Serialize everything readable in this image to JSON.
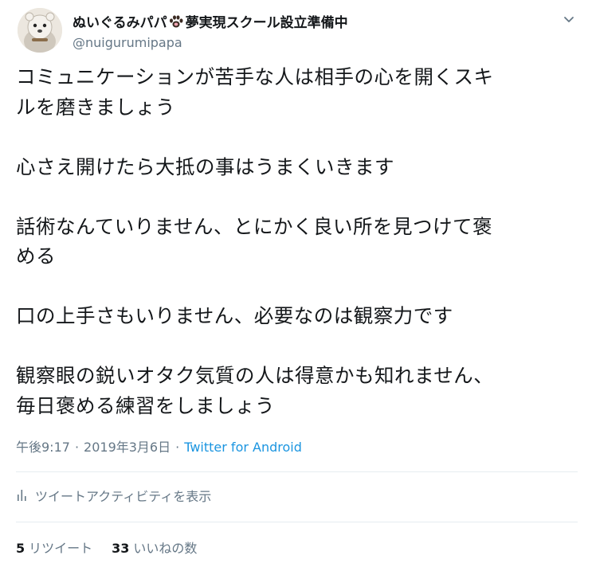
{
  "author": {
    "display_name": "ぬいぐるみパパ",
    "display_name_suffix": "夢実現スクール設立準備中",
    "handle": "@nuigurumipapa",
    "avatar_icon": "stuffed-toy-avatar",
    "badge_icon": "paw-icon"
  },
  "menu_icon": "chevron-down-icon",
  "tweet": {
    "paragraphs": [
      [
        "コミュニケーションが苦手な人は相手の心を開くスキ",
        "ルを磨きましょう"
      ],
      [
        "心さえ開けたら大抵の事はうまくいきます"
      ],
      [
        "話術なんていりません、とにかく良い所を見つけて褒",
        "める"
      ],
      [
        "口の上手さもいりません、必要なのは観察力です"
      ],
      [
        "観察眼の鋭いオタク気質の人は得意かも知れません、",
        "毎日褒める練習をしましょう"
      ]
    ]
  },
  "meta": {
    "time": "午後9:17",
    "separator": "·",
    "date": "2019年3月6日",
    "source": "Twitter for Android"
  },
  "activity": {
    "label": "ツイートアクティビティを表示",
    "icon": "bar-chart-icon"
  },
  "stats": {
    "retweets_count": "5",
    "retweets_label": "リツイート",
    "likes_count": "33",
    "likes_label": "いいねの数"
  },
  "colors": {
    "text": "#14171a",
    "muted": "#657786",
    "link": "#1b95e0",
    "divider": "#e6ecf0"
  }
}
